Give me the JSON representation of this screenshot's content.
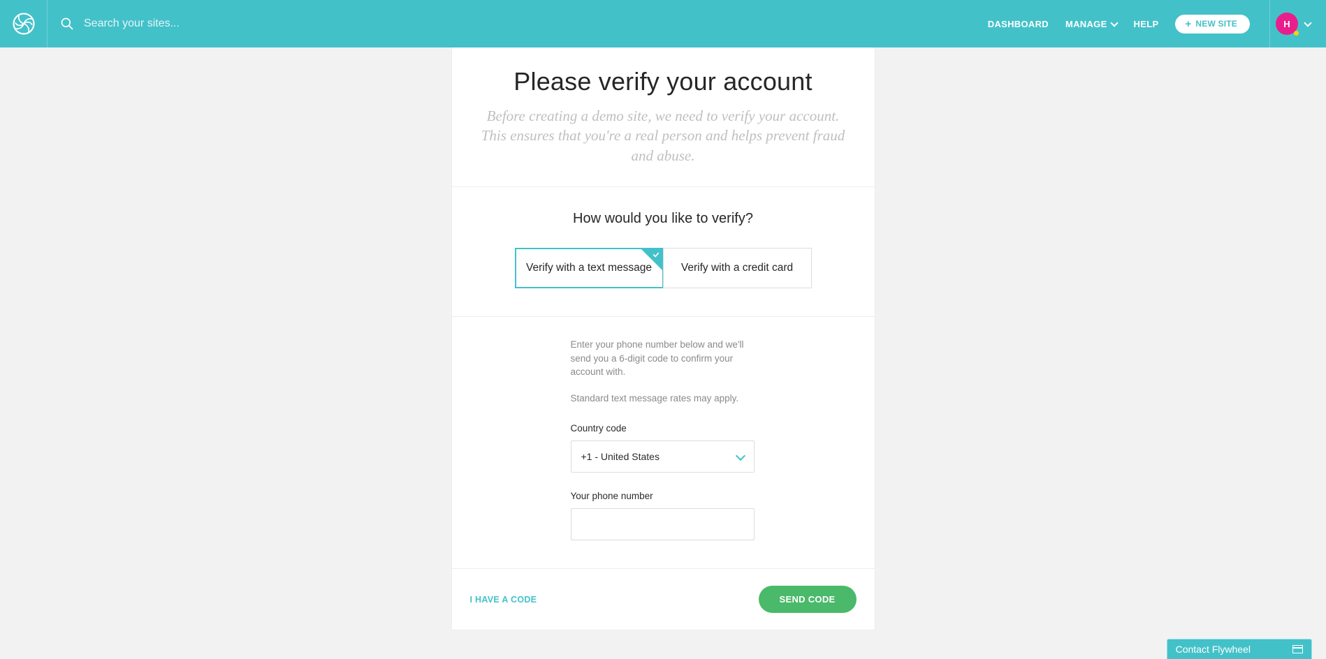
{
  "header": {
    "search_placeholder": "Search your sites...",
    "nav": {
      "dashboard": "DASHBOARD",
      "manage": "MANAGE",
      "help": "HELP",
      "new_site": "NEW SITE"
    },
    "avatar_initial": "H"
  },
  "page": {
    "title": "Please verify your account",
    "subtitle": "Before creating a demo site, we need to verify your account. This ensures that you're a real person and helps prevent fraud and abuse.",
    "how_title": "How would you like to verify?",
    "options": {
      "text": "Verify with a text message",
      "card": "Verify with a credit card"
    },
    "instructions_1": "Enter your phone number below and we'll send you a 6-digit code to confirm your account with.",
    "instructions_2": "Standard text message rates may apply.",
    "country_label": "Country code",
    "country_value": "+1 - United States",
    "phone_label": "Your phone number",
    "have_code": "I HAVE A CODE",
    "send": "SEND CODE"
  },
  "contact": {
    "label": "Contact Flywheel"
  },
  "colors": {
    "accent": "#43c1c9",
    "green": "#4ab96a",
    "pink": "#e91e8c"
  }
}
